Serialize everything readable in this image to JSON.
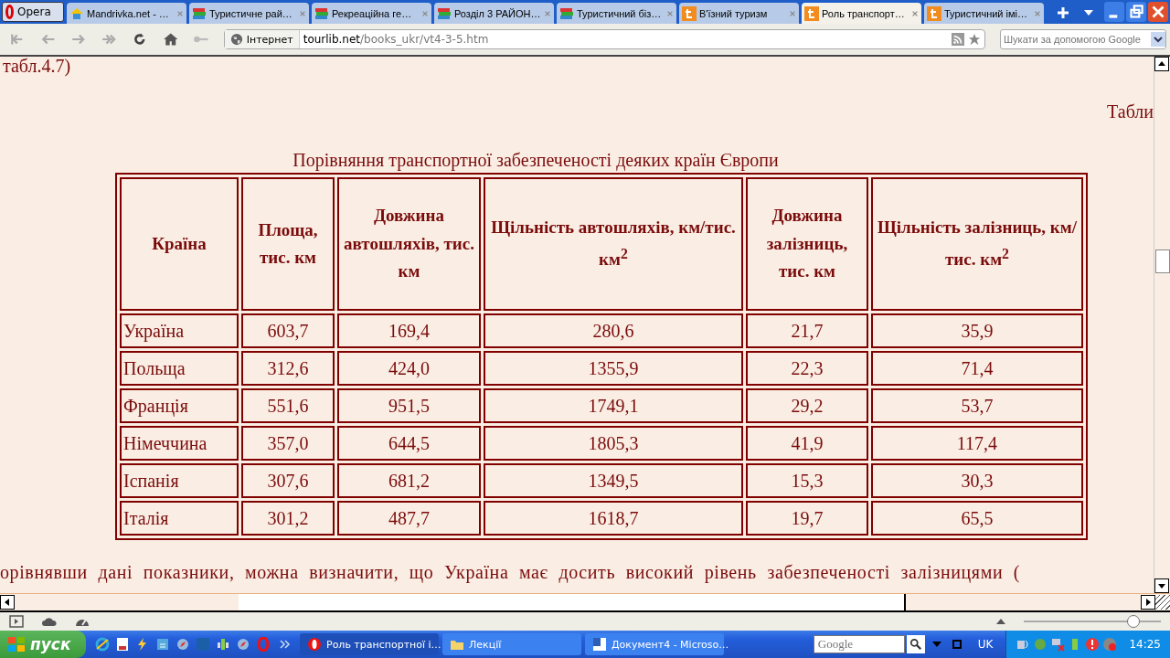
{
  "browser": {
    "menu_button": "Opera"
  },
  "tabs": [
    {
      "label": "Mandrivka.net - …",
      "kind": "house",
      "selected": false
    },
    {
      "label": "Туристичне рай…",
      "kind": "books",
      "selected": false
    },
    {
      "label": "Рекреаційна ге…",
      "kind": "books",
      "selected": false
    },
    {
      "label": "Розділ 3 РАЙОН…",
      "kind": "books",
      "selected": false
    },
    {
      "label": "Туристичний біз…",
      "kind": "books",
      "selected": false
    },
    {
      "label": "В'їзний туризм",
      "kind": "letter",
      "selected": false
    },
    {
      "label": "Роль транспорт…",
      "kind": "letter",
      "selected": true
    },
    {
      "label": "Туристичний імі…",
      "kind": "letter",
      "selected": false
    }
  ],
  "address_bar": {
    "zone": "Інтернет",
    "host": "tourlib.net",
    "path": "/books_ukr/vt4-3-5.htm"
  },
  "search": {
    "placeholder": "Шукати за допомогою Google"
  },
  "page": {
    "top_text": "табл.4.7)",
    "right_text": "Табли",
    "caption": "Порівняння транспортної забезпеченості деяких країн Європи",
    "table": {
      "columns": [
        "Країна",
        "Площа, тис. км",
        "Довжина автошляхів, тис. км",
        "Щільність автошляхів, км/тис. км$^{2}$",
        "Довжина залізниць, тис. км",
        "Щільність залізниць, км/тис. км$^{2}$"
      ],
      "rows": [
        [
          "Україна",
          "603,7",
          "169,4",
          "280,6",
          "21,7",
          "35,9"
        ],
        [
          "Польща",
          "312,6",
          "424,0",
          "1355,9",
          "22,3",
          "71,4"
        ],
        [
          "Франція",
          "551,6",
          "951,5",
          "1749,1",
          "29,2",
          "53,7"
        ],
        [
          "Німеччина",
          "357,0",
          "644,5",
          "1805,3",
          "41,9",
          "117,4"
        ],
        [
          "Іспанія",
          "307,6",
          "681,2",
          "1349,5",
          "15,3",
          "30,3"
        ],
        [
          "Італія",
          "301,2",
          "487,7",
          "1618,7",
          "19,7",
          "65,5"
        ]
      ]
    },
    "bottom_text": "орівнявши дані показники, можна визначити, що Україна має досить високий рівень забезпеченості залізницями ("
  },
  "status_bar": {
    "zoom": {
      "level": 0.8
    }
  },
  "taskbar": {
    "start": "пуск",
    "tasks": [
      {
        "label": "Роль транспортної і…",
        "kind": "opera",
        "selected": true
      },
      {
        "label": "Лекції",
        "kind": "folder",
        "selected": false
      },
      {
        "label": "Документ4 - Microso…",
        "kind": "word",
        "selected": false
      }
    ],
    "search_placeholder": "Google",
    "language": "UK",
    "clock": "14:25"
  }
}
